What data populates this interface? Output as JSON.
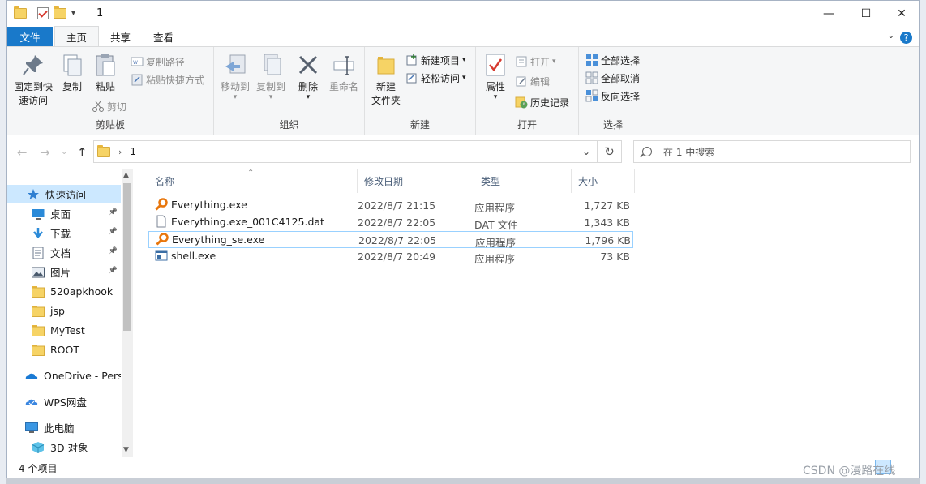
{
  "window": {
    "title": "1",
    "controls": {
      "minimize": "—",
      "maximize": "☐",
      "close": "✕"
    }
  },
  "ribbon_tabs": [
    {
      "label": "文件"
    },
    {
      "label": "主页"
    },
    {
      "label": "共享"
    },
    {
      "label": "查看"
    }
  ],
  "ribbon": {
    "clipboard": {
      "label": "剪贴板",
      "pin_quick_access": "固定到快\n速访问",
      "copy": "复制",
      "paste": "粘贴",
      "copy_path": "复制路径",
      "paste_shortcut": "粘贴快捷方式",
      "cut": "剪切"
    },
    "organize": {
      "label": "组织",
      "move_to": "移动到",
      "copy_to": "复制到",
      "delete": "删除",
      "rename": "重命名"
    },
    "new": {
      "label": "新建",
      "new_folder": "新建\n文件夹",
      "new_item": "新建项目",
      "easy_access": "轻松访问"
    },
    "open": {
      "label": "打开",
      "properties": "属性",
      "open": "打开",
      "edit": "编辑",
      "history": "历史记录"
    },
    "select": {
      "label": "选择",
      "select_all": "全部选择",
      "select_none": "全部取消",
      "invert": "反向选择"
    }
  },
  "address": {
    "path": "1",
    "search_placeholder": "在 1 中搜索"
  },
  "nav_pane": {
    "items": [
      {
        "label": "快速访问",
        "icon": "star-icon",
        "selected": true
      },
      {
        "label": "桌面",
        "icon": "desktop-icon",
        "pinned": true
      },
      {
        "label": "下载",
        "icon": "download-icon",
        "pinned": true
      },
      {
        "label": "文档",
        "icon": "document-icon",
        "pinned": true
      },
      {
        "label": "图片",
        "icon": "pictures-icon",
        "pinned": true
      },
      {
        "label": "520apkhook",
        "icon": "folder-icon"
      },
      {
        "label": "jsp",
        "icon": "folder-icon"
      },
      {
        "label": "MyTest",
        "icon": "folder-icon"
      },
      {
        "label": "ROOT",
        "icon": "folder-icon"
      },
      {
        "label": "OneDrive - Personal",
        "icon": "onedrive-icon"
      },
      {
        "label": "WPS网盘",
        "icon": "wps-cloud-icon"
      },
      {
        "label": "此电脑",
        "icon": "computer-icon"
      },
      {
        "label": "3D 对象",
        "icon": "3d-objects-icon"
      }
    ]
  },
  "file_list": {
    "columns": [
      "名称",
      "修改日期",
      "类型",
      "大小"
    ],
    "rows": [
      {
        "name": "Everything.exe",
        "date": "2022/8/7 21:15",
        "type": "应用程序",
        "size": "1,727 KB",
        "icon": "everything-icon"
      },
      {
        "name": "Everything.exe_001C4125.dat",
        "date": "2022/8/7 22:05",
        "type": "DAT 文件",
        "size": "1,343 KB",
        "icon": "file-icon"
      },
      {
        "name": "Everything_se.exe",
        "date": "2022/8/7 22:05",
        "type": "应用程序",
        "size": "1,796 KB",
        "icon": "everything-icon"
      },
      {
        "name": "shell.exe",
        "date": "2022/8/7 20:49",
        "type": "应用程序",
        "size": "73 KB",
        "icon": "exe-icon"
      }
    ]
  },
  "status": {
    "item_count": "4 个项目"
  },
  "watermark": "CSDN @漫路在线",
  "colors": {
    "accent": "#1979ca",
    "selection": "#cce8ff",
    "folder": "#f6d365"
  }
}
